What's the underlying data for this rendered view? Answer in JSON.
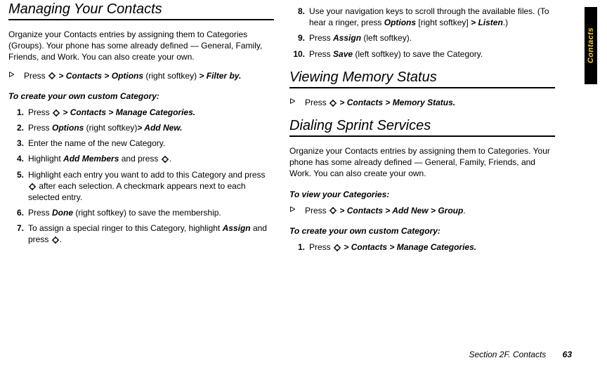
{
  "sidetab": "Contacts",
  "footer": {
    "section": "Section 2F. Contacts",
    "page": "63"
  },
  "left": {
    "h1": "Managing Your Contacts",
    "intro": "Organize your Contacts entries by assigning them to Categories (Groups). Your phone has some already defined — General, Family, Friends, and Work. You can also create your own.",
    "bullet1_pre": "Press ",
    "bullet1_a": " > ",
    "bullet1_b": "Contacts",
    "bullet1_c": " > ",
    "bullet1_d": "Options",
    "bullet1_e": " (right softkey) ",
    "bullet1_f": "> ",
    "bullet1_g": "Filter by.",
    "sub1": "To create your own custom Category:",
    "s1_pre": "Press ",
    "s1_a": " > ",
    "s1_b": "Contacts",
    "s1_c": " > ",
    "s1_d": "Manage Categories.",
    "s2_pre": "Press ",
    "s2_a": "Options",
    "s2_b": " (right softkey)",
    "s2_c": "> ",
    "s2_d": "Add New.",
    "s3": "Enter the name of the new Category.",
    "s4_pre": "Highlight ",
    "s4_a": "Add Members",
    "s4_b": " and press ",
    "s5_pre": "Highlight each entry you want to add to this Category and press ",
    "s5_post": " after each selection. A checkmark appears next to each selected entry.",
    "s6_pre": "Press ",
    "s6_a": "Done",
    "s6_b": " (right softkey) to save the membership.",
    "s7_pre": "To assign a special ringer to this Category, highlight ",
    "s7_a": "Assign",
    "s7_b": " and press "
  },
  "right": {
    "s8_pre": "Use your navigation keys to scroll through the available files. (To hear a ringer, press ",
    "s8_a": "Options",
    "s8_b": " [right softkey] ",
    "s8_c": "> ",
    "s8_d": "Listen",
    "s8_e": ".)",
    "s9_pre": "Press ",
    "s9_a": "Assign",
    "s9_b": " (left softkey).",
    "s10_pre": "Press ",
    "s10_a": "Save",
    "s10_b": " (left softkey) to save the Category.",
    "h2": "Viewing Memory Status",
    "vb_pre": "Press ",
    "vb_a": " > ",
    "vb_b": "Contacts",
    "vb_c": " > ",
    "vb_d": "Memory Status.",
    "h3": "Dialing Sprint Services",
    "intro2": "Organize your Contacts entries by assigning them to Categories. Your phone has some already defined — General, Family, Friends, and Work. You can also create your own.",
    "sub2": "To view your Categories:",
    "db_pre": "Press ",
    "db_a": " > ",
    "db_b": "Contacts",
    "db_c": " >  ",
    "db_d": "Add New",
    "db_e": " > ",
    "db_f": "Group",
    "db_g": ".",
    "sub3": "To create your own custom Category:",
    "d1_pre": "Press ",
    "d1_a": " > ",
    "d1_b": "Contacts",
    "d1_c": " > ",
    "d1_d": "Manage Categories."
  }
}
